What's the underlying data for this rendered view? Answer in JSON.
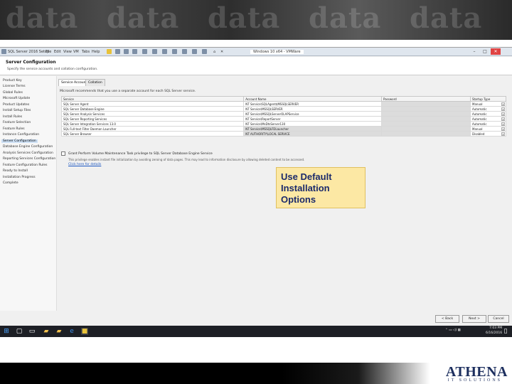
{
  "banner": {
    "watermark": "data"
  },
  "toolbar": {
    "app_tab": "SQL Server 2016 Setup",
    "menus": [
      "File",
      "Edit",
      "View",
      "VM",
      "Tabs",
      "Help"
    ],
    "window_tab": "Windows 10 x64 - VMWare",
    "controls": [
      "–",
      "□",
      "✕"
    ]
  },
  "header": {
    "title": "Server Configuration",
    "subtitle": "Specify the service accounts and collation configuration."
  },
  "sidebar": {
    "items": [
      "Product Key",
      "License Terms",
      "Global Rules",
      "Microsoft Update",
      "Product Updates",
      "Install Setup Files",
      "Install Rules",
      "Feature Selection",
      "Feature Rules",
      "Instance Configuration",
      "Server Configuration",
      "Database Engine Configuration",
      "Analysis Services Configuration",
      "Reporting Services Configuration",
      "Feature Configuration Rules",
      "Ready to Install",
      "Installation Progress",
      "Complete"
    ],
    "active_index": 10
  },
  "tabs": [
    "Service Accounts",
    "Collation"
  ],
  "description": "Microsoft recommends that you use a separate account for each SQL Server service.",
  "table": {
    "headers": [
      "Service",
      "Account Name",
      "Password",
      "Startup Type"
    ],
    "rows": [
      [
        "SQL Server Agent",
        "NT Service\\SQLAgent$MSSQLSERVER",
        "",
        "Manual"
      ],
      [
        "SQL Server Database Engine",
        "NT Service\\MSSQLSERVER",
        "",
        "Automatic"
      ],
      [
        "SQL Server Analysis Services",
        "NT Service\\MSSQLServerOLAPService",
        "",
        "Automatic"
      ],
      [
        "SQL Server Reporting Services",
        "NT Service\\ReportServer",
        "",
        "Automatic"
      ],
      [
        "SQL Server Integration Services 13.0",
        "NT Service\\MsDtsServer130",
        "",
        "Automatic"
      ],
      [
        "SQL Full-text Filter Daemon Launcher",
        "NT Service\\MSSQLFDLauncher",
        "",
        "Manual"
      ],
      [
        "SQL Server Browser",
        "NT AUTHORITY\\LOCAL SERVICE",
        "",
        "Disabled"
      ]
    ]
  },
  "checkbox_label": "Grant Perform Volume Maintenance Task privilege to SQL Server Database Engine Service",
  "note": "This privilege enables instant file initialization by avoiding zeroing of data pages. This may lead to information disclosure by allowing deleted content to be accessed.",
  "link": "Click here for details",
  "buttons": {
    "back": "< Back",
    "next": "Next >",
    "cancel": "Cancel"
  },
  "callout": {
    "line1": "Use Default",
    "line2": "Installation",
    "line3": "Options"
  },
  "taskbar": {
    "time": "7:03 PM",
    "date": "6/16/2016"
  },
  "logo": {
    "main": "ATHENA",
    "sub": "IT SOLUTIONS"
  }
}
